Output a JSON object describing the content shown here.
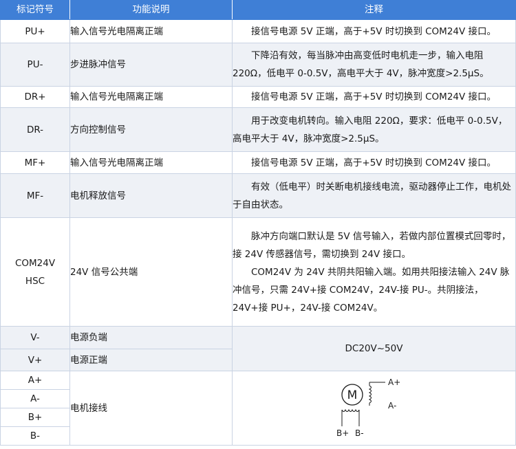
{
  "header": {
    "symbol": "标记符号",
    "function": "功能说明",
    "note": "注释"
  },
  "rows": [
    {
      "symbol": "PU+",
      "function": "输入信号光电隔离正端",
      "note": [
        "接信号电源 5V 正端，高于+5V 时切换到 COM24V 接口。"
      ]
    },
    {
      "symbol": "PU-",
      "function": "步进脉冲信号",
      "note": [
        "下降沿有效，每当脉冲由高变低时电机走一步，输入电阻 220Ω，低电平 0-0.5V，高电平大于 4V，脉冲宽度>2.5μS。"
      ]
    },
    {
      "symbol": "DR+",
      "function": "输入信号光电隔离正端",
      "note": [
        "接信号电源 5V 正端，高于+5V 时切换到 COM24V 接口。"
      ]
    },
    {
      "symbol": "DR-",
      "function": "方向控制信号",
      "note": [
        "用于改变电机转向。输入电阻 220Ω，要求：低电平 0-0.5V，高电平大于 4V，脉冲宽度>2.5μS。"
      ]
    },
    {
      "symbol": "MF+",
      "function": "输入信号光电隔离正端",
      "note": [
        "接信号电源 5V 正端，高于+5V 时切换到 COM24V 接口。"
      ]
    },
    {
      "symbol": "MF-",
      "function": "电机释放信号",
      "note": [
        "有效（低电平）时关断电机接线电流，驱动器停止工作，电机处于自由状态。"
      ]
    },
    {
      "symbol_line1": "COM24V",
      "symbol_line2": "HSC",
      "function": "24V 信号公共端",
      "note": [
        "脉冲方向端口默认是 5V 信号输入，若做内部位置模式回零时，接 24V 传感器信号，需切换到 24V 接口。",
        "COM24V 为 24V 共阴共阳输入端。如用共阳接法输入 24V 脉冲信号，只需 24V+接 COM24V，24V-接 PU-。共阴接法，24V+接 PU+，24V-接 COM24V。"
      ]
    }
  ],
  "power": {
    "v_minus": {
      "symbol": "V-",
      "function": "电源负端"
    },
    "v_plus": {
      "symbol": "V+",
      "function": "电源正端"
    },
    "note": "DC20V~50V"
  },
  "motor": {
    "symbols": [
      "A+",
      "A-",
      "B+",
      "B-"
    ],
    "function": "电机接线",
    "diagram": {
      "motor_label": "M",
      "a_plus": "A+",
      "a_minus": "A-",
      "b_plus": "B+",
      "b_minus": "B-"
    }
  }
}
